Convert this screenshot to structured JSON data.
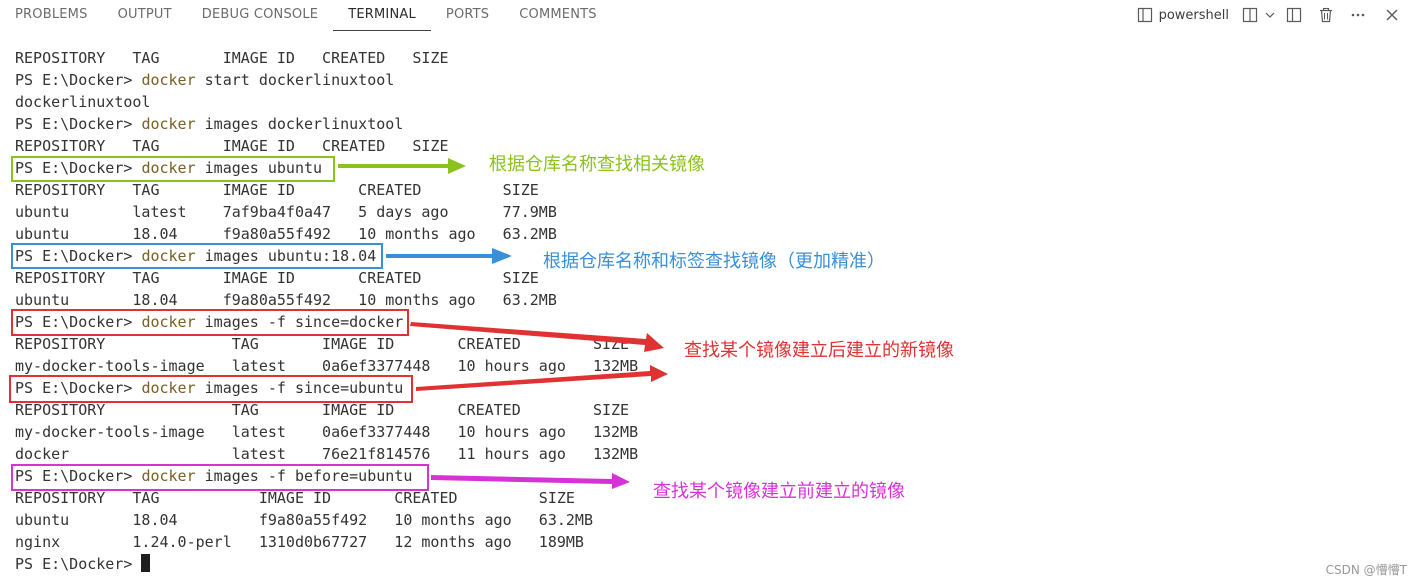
{
  "panel": {
    "tabs": [
      {
        "label": "PROBLEMS"
      },
      {
        "label": "OUTPUT"
      },
      {
        "label": "DEBUG CONSOLE"
      },
      {
        "label": "TERMINAL"
      },
      {
        "label": "PORTS"
      },
      {
        "label": "COMMENTS"
      }
    ],
    "active_tab": "TERMINAL",
    "shell_name": "powershell"
  },
  "terminal": {
    "lines": [
      {
        "type": "out",
        "text": "REPOSITORY   TAG       IMAGE ID   CREATED   SIZE"
      },
      {
        "type": "cmd",
        "prompt": "PS E:\\Docker> ",
        "command": "docker",
        "args": " start dockerlinuxtool"
      },
      {
        "type": "out",
        "text": "dockerlinuxtool"
      },
      {
        "type": "cmd",
        "prompt": "PS E:\\Docker> ",
        "command": "docker",
        "args": " images dockerlinuxtool"
      },
      {
        "type": "out",
        "text": "REPOSITORY   TAG       IMAGE ID   CREATED   SIZE"
      },
      {
        "type": "cmd",
        "prompt": "PS E:\\Docker> ",
        "command": "docker",
        "args": " images ubuntu"
      },
      {
        "type": "out",
        "text": "REPOSITORY   TAG       IMAGE ID       CREATED         SIZE"
      },
      {
        "type": "out",
        "text": "ubuntu       latest    7af9ba4f0a47   5 days ago      77.9MB"
      },
      {
        "type": "out",
        "text": "ubuntu       18.04     f9a80a55f492   10 months ago   63.2MB"
      },
      {
        "type": "cmd",
        "prompt": "PS E:\\Docker> ",
        "command": "docker",
        "args": " images ubuntu:18.04"
      },
      {
        "type": "out",
        "text": "REPOSITORY   TAG       IMAGE ID       CREATED         SIZE"
      },
      {
        "type": "out",
        "text": "ubuntu       18.04     f9a80a55f492   10 months ago   63.2MB"
      },
      {
        "type": "cmd",
        "prompt": "PS E:\\Docker> ",
        "command": "docker",
        "args": " images -f since=docker"
      },
      {
        "type": "out",
        "text": "REPOSITORY              TAG       IMAGE ID       CREATED        SIZE"
      },
      {
        "type": "out",
        "text": "my-docker-tools-image   latest    0a6ef3377448   10 hours ago   132MB"
      },
      {
        "type": "cmd",
        "prompt": "PS E:\\Docker> ",
        "command": "docker",
        "args": " images -f since=ubuntu"
      },
      {
        "type": "out",
        "text": "REPOSITORY              TAG       IMAGE ID       CREATED        SIZE"
      },
      {
        "type": "out",
        "text": "my-docker-tools-image   latest    0a6ef3377448   10 hours ago   132MB"
      },
      {
        "type": "out",
        "text": "docker                  latest    76e21f814576   11 hours ago   132MB"
      },
      {
        "type": "cmd",
        "prompt": "PS E:\\Docker> ",
        "command": "docker",
        "args": " images -f before=ubuntu"
      },
      {
        "type": "out",
        "text": "REPOSITORY   TAG           IMAGE ID       CREATED         SIZE"
      },
      {
        "type": "out",
        "text": "ubuntu       18.04         f9a80a55f492   10 months ago   63.2MB"
      },
      {
        "type": "out",
        "text": "nginx        1.24.0-perl   1310d0b67727   12 months ago   189MB"
      },
      {
        "type": "prompt",
        "prompt": "PS E:\\Docker> "
      }
    ]
  },
  "annotations": [
    {
      "text": "根据仓库名称查找相关镜像",
      "color": "#8cc21c"
    },
    {
      "text": "根据仓库名称和标签查找镜像（更加精准）",
      "color": "#3a8fd8"
    },
    {
      "text": "查找某个镜像建立后建立的新镜像",
      "color": "#e03232"
    },
    {
      "text": "查找某个镜像建立前建立的镜像",
      "color": "#d633d6"
    }
  ],
  "watermark": "CSDN @懵懵T"
}
